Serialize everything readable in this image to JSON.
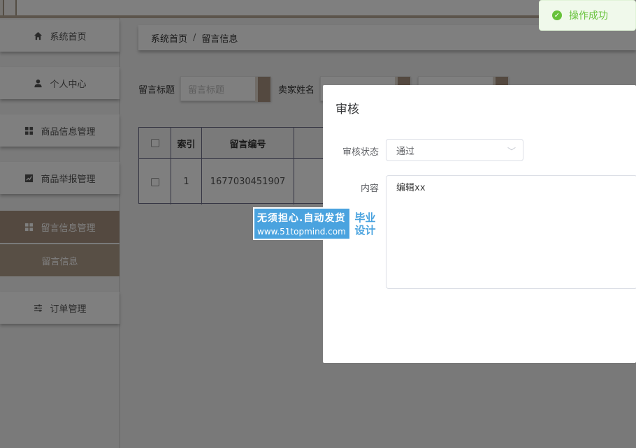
{
  "sidebar": {
    "items": [
      {
        "label": "系统首页",
        "icon": "home-icon"
      },
      {
        "label": "个人中心",
        "icon": "user-icon"
      },
      {
        "label": "商品信息管理",
        "icon": "grid-icon"
      },
      {
        "label": "商品举报管理",
        "icon": "chart-icon"
      },
      {
        "label": "留言信息管理",
        "icon": "grid-icon"
      },
      {
        "label": "订单管理",
        "icon": "sliders-icon"
      }
    ],
    "sub_item": "留言信息"
  },
  "breadcrumb": {
    "home": "系统首页",
    "separator": "/",
    "current": "留言信息"
  },
  "search": {
    "title_label": "留言标题",
    "title_placeholder": "留言标题",
    "seller_label": "卖家姓名"
  },
  "table": {
    "headers": [
      "索引",
      "留言编号"
    ],
    "rows": [
      {
        "index": "1",
        "code": "1677030451907"
      }
    ]
  },
  "toast": {
    "text": "操作成功",
    "color": "#67c23a"
  },
  "dialog": {
    "title": "审核",
    "status_label": "审核状态",
    "status_value": "通过",
    "content_label": "内容",
    "content_value": "编辑xx"
  },
  "watermark": {
    "line1": "无须担心.自动发货",
    "line2": "www.51topmind.com",
    "badge1": "毕业",
    "badge2": "设计"
  }
}
